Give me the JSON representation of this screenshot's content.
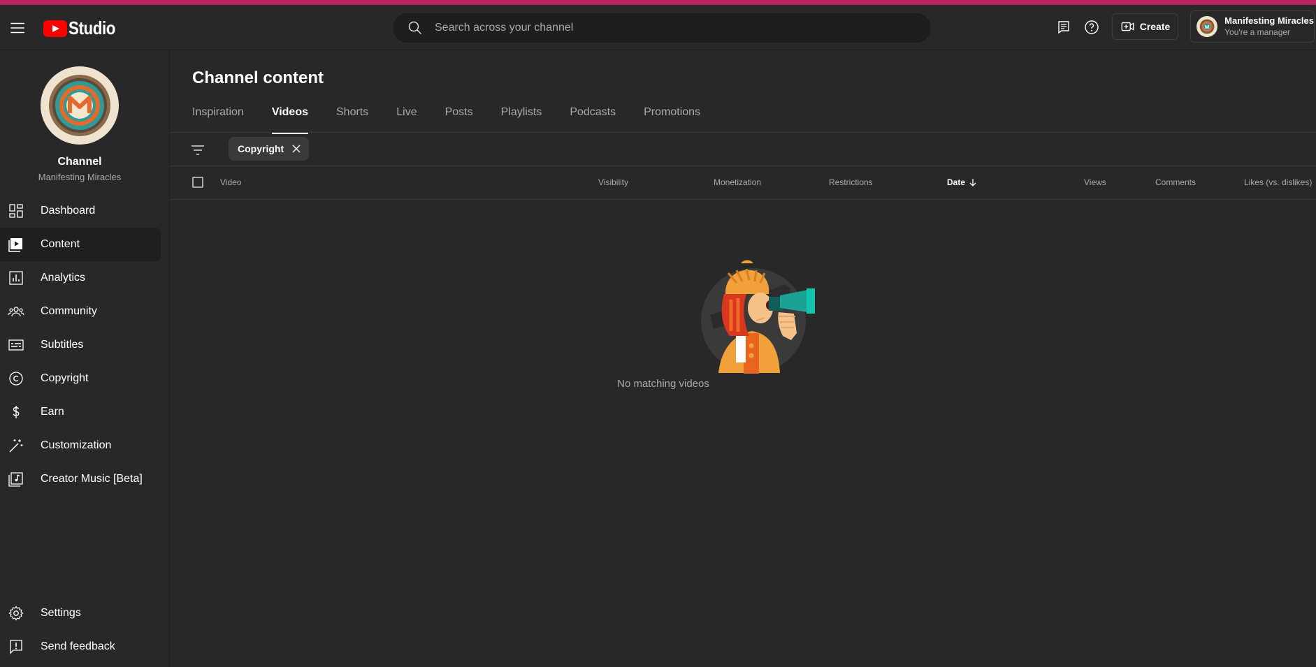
{
  "app": {
    "title": "Studio"
  },
  "search": {
    "placeholder": "Search across your channel"
  },
  "header": {
    "create_label": "Create",
    "account_name": "Manifesting Miracles",
    "account_role": "You're a manager"
  },
  "sidebar": {
    "channel_label": "Channel",
    "channel_name": "Manifesting Miracles",
    "items": [
      {
        "label": "Dashboard",
        "icon": "dashboard-icon"
      },
      {
        "label": "Content",
        "icon": "content-icon",
        "active": true
      },
      {
        "label": "Analytics",
        "icon": "analytics-icon"
      },
      {
        "label": "Community",
        "icon": "community-icon"
      },
      {
        "label": "Subtitles",
        "icon": "subtitles-icon"
      },
      {
        "label": "Copyright",
        "icon": "copyright-icon"
      },
      {
        "label": "Earn",
        "icon": "earn-icon"
      },
      {
        "label": "Customization",
        "icon": "customization-icon"
      },
      {
        "label": "Creator Music [Beta]",
        "icon": "creator-music-icon"
      }
    ],
    "bottom_items": [
      {
        "label": "Settings",
        "icon": "settings-icon"
      },
      {
        "label": "Send feedback",
        "icon": "feedback-icon"
      }
    ]
  },
  "main": {
    "title": "Channel content",
    "tabs": [
      "Inspiration",
      "Videos",
      "Shorts",
      "Live",
      "Posts",
      "Playlists",
      "Podcasts",
      "Promotions"
    ],
    "active_tab": "Videos",
    "filter_chip": "Copyright",
    "columns": {
      "video": "Video",
      "visibility": "Visibility",
      "monetization": "Monetization",
      "restrictions": "Restrictions",
      "date": "Date",
      "views": "Views",
      "comments": "Comments",
      "likes": "Likes (vs. dislikes)"
    },
    "sort_column": "Date",
    "empty_message": "No matching videos"
  },
  "colors": {
    "accent_bar": "#b8225f",
    "background": "#282828",
    "brand_red": "#ff0000"
  }
}
